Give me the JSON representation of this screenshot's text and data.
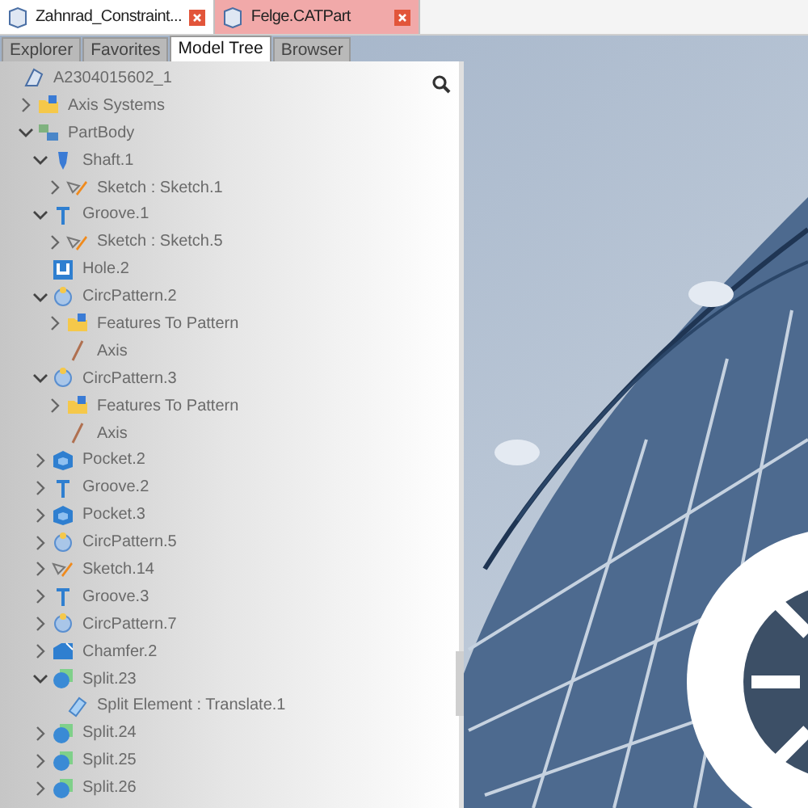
{
  "document_tabs": [
    {
      "label": "Zahnrad_Constraint...",
      "selected": false
    },
    {
      "label": "Felge.CATPart",
      "selected": true
    }
  ],
  "panel_tabs": [
    {
      "label": "Explorer",
      "selected": false
    },
    {
      "label": "Favorites",
      "selected": false
    },
    {
      "label": "Model Tree",
      "selected": true
    },
    {
      "label": "Browser",
      "selected": false
    }
  ],
  "tree": {
    "label": "A2304015602_1",
    "kind": "part",
    "children": [
      {
        "label": "Axis Systems",
        "kind": "folder",
        "expanded": false
      },
      {
        "label": "PartBody",
        "kind": "body",
        "expanded": true,
        "children": [
          {
            "label": "Shaft.1",
            "kind": "shaft",
            "expanded": true,
            "children": [
              {
                "label": "Sketch : Sketch.1",
                "kind": "sketch",
                "expanded": false
              }
            ]
          },
          {
            "label": "Groove.1",
            "kind": "groove",
            "expanded": true,
            "children": [
              {
                "label": "Sketch : Sketch.5",
                "kind": "sketch",
                "expanded": false
              }
            ]
          },
          {
            "label": "Hole.2",
            "kind": "hole"
          },
          {
            "label": "CircPattern.2",
            "kind": "pattern",
            "expanded": true,
            "children": [
              {
                "label": "Features To Pattern",
                "kind": "folder",
                "expanded": false
              },
              {
                "label": "Axis",
                "kind": "axis"
              }
            ]
          },
          {
            "label": "CircPattern.3",
            "kind": "pattern",
            "expanded": true,
            "children": [
              {
                "label": "Features To Pattern",
                "kind": "folder",
                "expanded": false
              },
              {
                "label": "Axis",
                "kind": "axis"
              }
            ]
          },
          {
            "label": "Pocket.2",
            "kind": "pocket",
            "expanded": false
          },
          {
            "label": "Groove.2",
            "kind": "groove",
            "expanded": false
          },
          {
            "label": "Pocket.3",
            "kind": "pocket",
            "expanded": false
          },
          {
            "label": "CircPattern.5",
            "kind": "pattern",
            "expanded": false
          },
          {
            "label": "Sketch.14",
            "kind": "sketch",
            "expanded": false
          },
          {
            "label": "Groove.3",
            "kind": "groove",
            "expanded": false
          },
          {
            "label": "CircPattern.7",
            "kind": "pattern",
            "expanded": false
          },
          {
            "label": "Chamfer.2",
            "kind": "chamfer",
            "expanded": false
          },
          {
            "label": "Split.23",
            "kind": "split",
            "expanded": true,
            "children": [
              {
                "label": "Split Element : Translate.1",
                "kind": "element"
              }
            ]
          },
          {
            "label": "Split.24",
            "kind": "split",
            "expanded": false
          },
          {
            "label": "Split.25",
            "kind": "split",
            "expanded": false
          },
          {
            "label": "Split.26",
            "kind": "split",
            "expanded": false
          }
        ]
      }
    ]
  }
}
